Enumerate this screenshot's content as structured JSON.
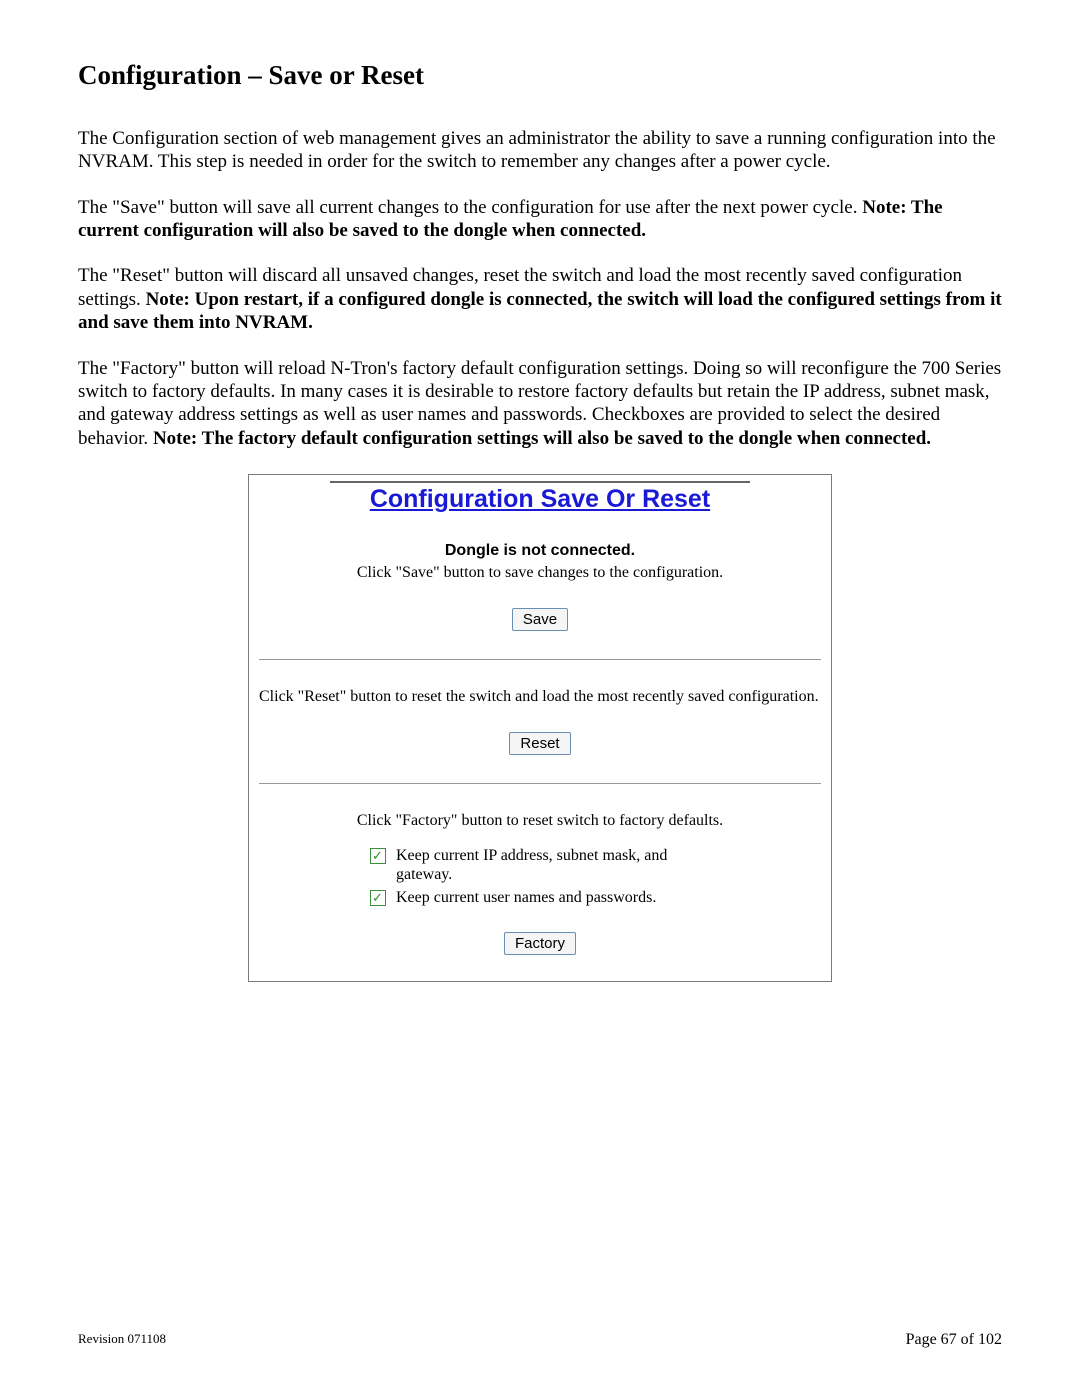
{
  "heading": "Configuration – Save or Reset",
  "para1": "The Configuration section of web management gives an administrator the ability to save a running configuration into the NVRAM.  This step is needed in order for the switch to remember any changes after a power cycle.",
  "para2_plain": "The \"Save\" button will save all current changes to the configuration for use after the next power cycle. ",
  "para2_bold": "Note: The current configuration will also be saved to the dongle when connected.",
  "para3_plain": "The \"Reset\" button will discard all unsaved changes, reset the switch and load the most recently saved configuration settings. ",
  "para3_bold": "Note: Upon restart, if a configured dongle is connected, the switch will load the configured settings from it and save them into NVRAM.",
  "para4_plain": "The \"Factory\" button will reload N-Tron's factory default configuration settings.  Doing so will reconfigure the 700 Series switch to factory defaults.  In many cases it is desirable to restore factory defaults but retain the IP address, subnet mask, and gateway address settings as well as user names and passwords.  Checkboxes are provided to select the desired behavior. ",
  "para4_bold": "Note: The factory default configuration settings will also be saved to the dongle when connected.",
  "panel": {
    "title": "Configuration Save Or Reset",
    "dongle_status": "Dongle is not connected.",
    "save_hint": "Click \"Save\" button to save changes to the configuration.",
    "save_btn": "Save",
    "reset_hint": "Click \"Reset\" button to reset the switch and load the most recently saved configuration.",
    "reset_btn": "Reset",
    "factory_hint": "Click \"Factory\" button to reset switch to factory defaults.",
    "cb1_label": "Keep current IP address, subnet mask, and gateway.",
    "cb2_label": "Keep current user names and passwords.",
    "factory_btn": "Factory"
  },
  "footer": {
    "revision": "Revision 071108",
    "page": "Page 67 of 102"
  }
}
